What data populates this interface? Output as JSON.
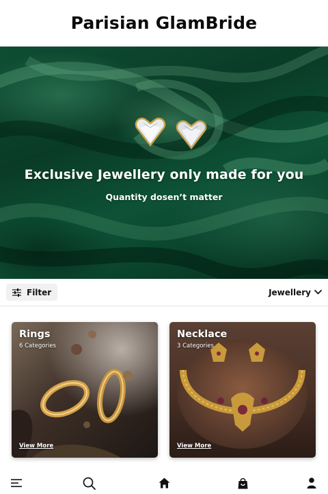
{
  "header": {
    "brand": "Parisian GlamBride"
  },
  "hero": {
    "title": "Exclusive Jewellery only made for you",
    "subtitle": "Quantity dosen’t matter"
  },
  "toolbar": {
    "filter_label": "Filter",
    "filter_icon": "sliders-icon",
    "category_label": "Jewellery",
    "category_icon": "chevron-down-icon"
  },
  "categories": [
    {
      "title": "Rings",
      "count": "6 Categories",
      "link": "View More"
    },
    {
      "title": "Necklace",
      "count": "3 Categories",
      "link": "View More"
    }
  ],
  "nav": {
    "items": [
      "menu-icon",
      "search-icon",
      "home-icon",
      "shopping-bag-icon",
      "profile-icon"
    ]
  },
  "colors": {
    "hero_green": "#0d5237",
    "text_dark": "#111111",
    "filter_bg": "#f1f1f1"
  }
}
